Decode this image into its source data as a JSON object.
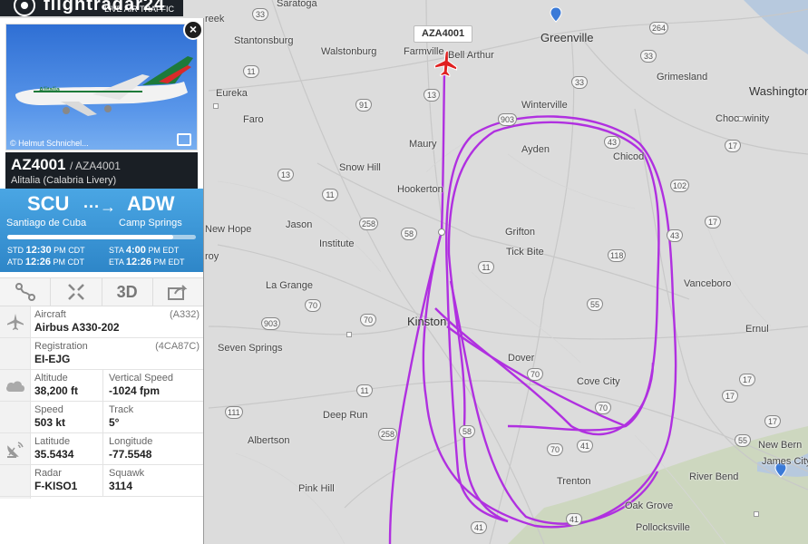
{
  "logo": {
    "brand": "flightradar24",
    "tagline": "LIVE AIR TRAFFIC"
  },
  "photo": {
    "credit": "© Helmut Schnichel..."
  },
  "flight": {
    "number": "AZ4001",
    "callsign": "/ AZA4001",
    "airline": "Alitalia (Calabria Livery)"
  },
  "route": {
    "from_code": "SCU",
    "from_city": "Santiago de Cuba",
    "to_code": "ADW",
    "to_city": "Camp Springs",
    "progress": 0.88,
    "std_label": "STD",
    "std": "12:30",
    "std_ampm": "PM",
    "std_tz": "CDT",
    "atd_label": "ATD",
    "atd": "12:26",
    "atd_ampm": "PM",
    "atd_tz": "CDT",
    "sta_label": "STA",
    "sta": "4:00",
    "sta_ampm": "PM",
    "sta_tz": "EDT",
    "eta_label": "ETA",
    "eta": "12:26",
    "eta_ampm": "PM",
    "eta_tz": "EDT"
  },
  "toolbar": {
    "view3d": "3D"
  },
  "details": {
    "aircraft_label": "Aircraft",
    "aircraft": "Airbus A330-202",
    "aircraft_code": "(A332)",
    "registration_label": "Registration",
    "registration": "EI-EJG",
    "registration_code": "(4CA87C)",
    "altitude_label": "Altitude",
    "altitude": "38,200 ft",
    "vspeed_label": "Vertical Speed",
    "vspeed": "-1024 fpm",
    "speed_label": "Speed",
    "speed": "503 kt",
    "track_label": "Track",
    "track": "5°",
    "latitude_label": "Latitude",
    "latitude": "35.5434",
    "longitude_label": "Longitude",
    "longitude": "-77.5548",
    "radar_label": "Radar",
    "radar": "F-KISO1",
    "squawk_label": "Squawk",
    "squawk": "3114"
  },
  "map": {
    "callsign_label": "AZA4001",
    "track_color": "#b030e0",
    "cities": [
      "Greenville",
      "Kinston",
      "Washington"
    ],
    "towns": [
      "Saratoga",
      "Stantonsburg",
      "Walstonburg",
      "Farmville",
      "Bell Arthur",
      "Winterville",
      "Grimesland",
      "Eureka",
      "Faro",
      "Maury",
      "Ayden",
      "Chicod",
      "Chocowinity",
      "Snow Hill",
      "Hookerton",
      "Grifton",
      "Tick Bite",
      "New Hope",
      "Jason",
      "Institute",
      "Vanceboro",
      "La Grange",
      "Ernul",
      "Seven Springs",
      "Dover",
      "Cove City",
      "Deep Run",
      "Albertson",
      "New Bern",
      "James City",
      "Trenton",
      "River Bend",
      "Pink Hill",
      "Oak Grove",
      "Pollocksville",
      "reek",
      "roy"
    ],
    "shields": [
      "11",
      "13",
      "91",
      "903",
      "58",
      "258",
      "11",
      "118",
      "43",
      "102",
      "55",
      "17",
      "70",
      "70",
      "903",
      "11",
      "258",
      "58",
      "70",
      "17",
      "43",
      "264",
      "33",
      "13",
      "33",
      "33",
      "17",
      "41",
      "70",
      "111",
      "55",
      "41",
      "11",
      "41",
      "70",
      "17",
      "17",
      "11"
    ]
  }
}
